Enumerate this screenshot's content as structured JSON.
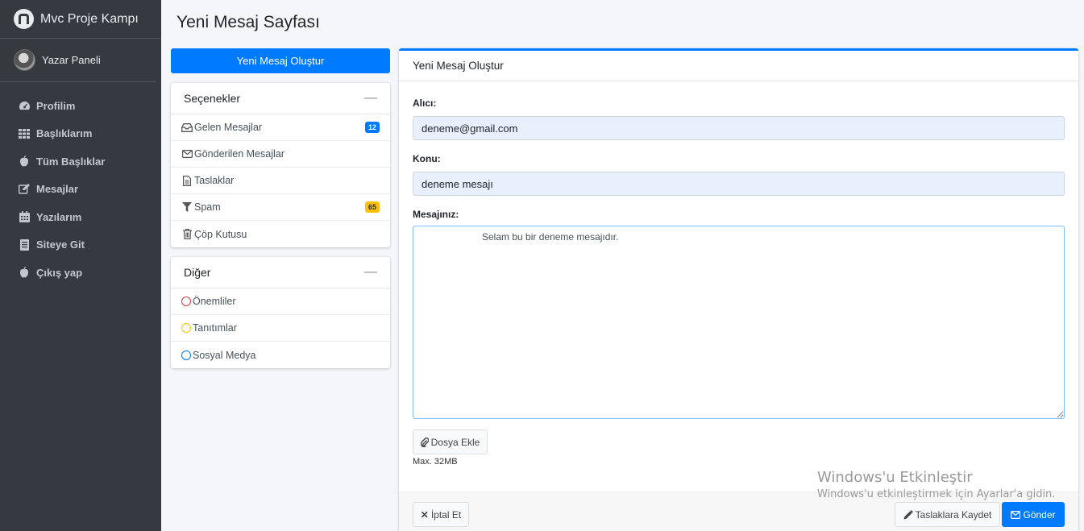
{
  "sidebar": {
    "brand": "Mvc Proje Kampı",
    "user": "Yazar Paneli",
    "items": [
      {
        "label": "Profilim",
        "icon": "dashboard-icon"
      },
      {
        "label": "Başlıklarım",
        "icon": "grid-icon"
      },
      {
        "label": "Tüm Başlıklar",
        "icon": "apple-icon"
      },
      {
        "label": "Mesajlar",
        "icon": "edit-icon"
      },
      {
        "label": "Yazılarım",
        "icon": "calendar-icon"
      },
      {
        "label": "Siteye Git",
        "icon": "document-icon"
      },
      {
        "label": "Çıkış yap",
        "icon": "apple-icon"
      }
    ]
  },
  "page": {
    "title": "Yeni Mesaj Sayfası"
  },
  "compose_button": "Yeni Mesaj Oluştur",
  "options_card": {
    "title": "Seçenekler",
    "items": [
      {
        "label": "Gelen Mesajlar",
        "icon": "inbox-icon",
        "badge": "12"
      },
      {
        "label": "Gönderilen Mesajlar",
        "icon": "envelope-icon"
      },
      {
        "label": "Taslaklar",
        "icon": "file-icon"
      },
      {
        "label": "Spam",
        "icon": "filter-icon",
        "badge": "65"
      },
      {
        "label": "Çöp Kutusu",
        "icon": "trash-icon"
      }
    ]
  },
  "other_card": {
    "title": "Diğer",
    "items": [
      {
        "label": "Önemliler",
        "color": "#dc3545"
      },
      {
        "label": "Tanıtımlar",
        "color": "#ffc107"
      },
      {
        "label": "Sosyal Medya",
        "color": "#007bff"
      }
    ]
  },
  "form": {
    "header": "Yeni Mesaj Oluştur",
    "to_label": "Alıcı:",
    "to_value": "deneme@gmail.com",
    "subject_label": "Konu:",
    "subject_value": "deneme mesajı",
    "message_label": "Mesajınız:",
    "message_value": "Selam bu bir deneme mesajıdır.",
    "attach_label": "Dosya Ekle",
    "attach_help": "Max. 32MB",
    "cancel_label": "İptal Et",
    "draft_label": "Taslaklara Kaydet",
    "send_label": "Gönder"
  },
  "watermark": {
    "title": "Windows'u Etkinleştir",
    "subtitle": "Windows'u etkinleştirmek için Ayarlar'a gidin."
  }
}
